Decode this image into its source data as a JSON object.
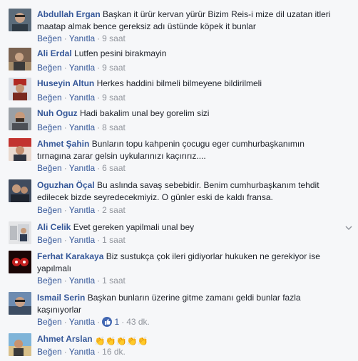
{
  "comments": [
    {
      "author": "Abdullah Ergan",
      "text": "Başkan it ürür kervan yürür Bizim Reis-i mize dil uzatan itleri maatap almak bence gereksiz adı üstünde köpek it bunlar",
      "like": "Beğen",
      "reply": "Yanıtla",
      "time": "9 saat",
      "avatar_color": "#5b6b7a"
    },
    {
      "author": "Ali Erdal",
      "text": "Lutfen pesini birakmayin",
      "like": "Beğen",
      "reply": "Yanıtla",
      "time": "9 saat",
      "avatar_color": "#7a6250"
    },
    {
      "author": "Huseyin Altun",
      "text": "Herkes haddini bilmeli bilmeyene bildirilmeli",
      "like": "Beğen",
      "reply": "Yanıtla",
      "time": "9 saat",
      "avatar_color": "#8a3b2a"
    },
    {
      "author": "Nuh Oguz",
      "text": "Hadi bakalim unal bey gorelim sizi",
      "like": "Beğen",
      "reply": "Yanıtla",
      "time": "8 saat",
      "avatar_color": "#6b5a4c"
    },
    {
      "author": "Ahmet Şahin",
      "text": "Bunların topu kahpenin çocugu eger cumhurbaşkanımın tırnagına zarar gelsin uykularınızı kaçırırız....",
      "like": "Beğen",
      "reply": "Yanıtla",
      "time": "6 saat",
      "avatar_color": "#b33a3a"
    },
    {
      "author": "Oguzhan Öçal",
      "text": "Bu aslında savaş sebebidir. Benim cumhurbaşkanım tehdit edilecek bizde seyredecekmiyiz. O günler eski de kaldı fransa.",
      "like": "Beğen",
      "reply": "Yanıtla",
      "time": "2 saat",
      "avatar_color": "#4d5a6e"
    },
    {
      "author": "Ali Celik",
      "text": "Evet gereken yapilmali unal bey",
      "like": "Beğen",
      "reply": "Yanıtla",
      "time": "1 saat",
      "avatar_color": "#8d8f93"
    },
    {
      "author": "Ferhat Karakaya",
      "text": "Biz sustukça çok ileri gidiyorlar hukuken ne gerekiyor ise yapılmalı",
      "like": "Beğen",
      "reply": "Yanıtla",
      "time": "1 saat",
      "avatar_color": "#2a0d0d"
    },
    {
      "author": "Ismail Serin",
      "text": "Başkan bunların üzerine gitme zamanı geldi bunlar fazla kaşınıyorlar",
      "like": "Beğen",
      "reply": "Yanıtla",
      "reactions": "1",
      "time": "43 dk.",
      "avatar_color": "#4f6a86"
    },
    {
      "author": "Ahmet Arslan",
      "text": "",
      "emoji": "👏👏👏👏👏",
      "like": "Beğen",
      "reply": "Yanıtla",
      "time": "16 dk.",
      "avatar_color": "#c9a46a"
    }
  ],
  "colors": {
    "author": "#365899",
    "text": "#1d2129",
    "meta": "#90949c",
    "background": "#f6f7f9",
    "like_blue": "#4267b2"
  }
}
